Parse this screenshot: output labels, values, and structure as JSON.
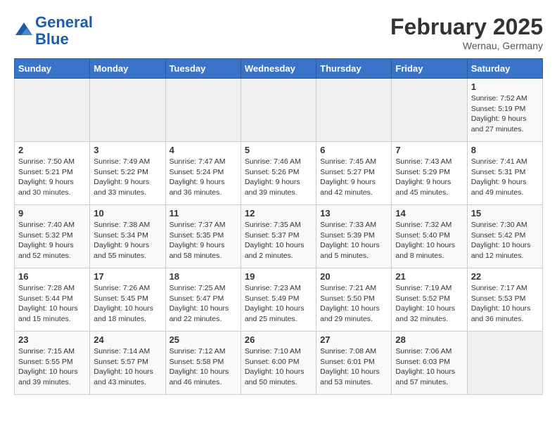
{
  "header": {
    "logo_line1": "General",
    "logo_line2": "Blue",
    "month_year": "February 2025",
    "location": "Wernau, Germany"
  },
  "weekdays": [
    "Sunday",
    "Monday",
    "Tuesday",
    "Wednesday",
    "Thursday",
    "Friday",
    "Saturday"
  ],
  "weeks": [
    [
      {
        "day": "",
        "info": ""
      },
      {
        "day": "",
        "info": ""
      },
      {
        "day": "",
        "info": ""
      },
      {
        "day": "",
        "info": ""
      },
      {
        "day": "",
        "info": ""
      },
      {
        "day": "",
        "info": ""
      },
      {
        "day": "1",
        "info": "Sunrise: 7:52 AM\nSunset: 5:19 PM\nDaylight: 9 hours and 27 minutes."
      }
    ],
    [
      {
        "day": "2",
        "info": "Sunrise: 7:50 AM\nSunset: 5:21 PM\nDaylight: 9 hours and 30 minutes."
      },
      {
        "day": "3",
        "info": "Sunrise: 7:49 AM\nSunset: 5:22 PM\nDaylight: 9 hours and 33 minutes."
      },
      {
        "day": "4",
        "info": "Sunrise: 7:47 AM\nSunset: 5:24 PM\nDaylight: 9 hours and 36 minutes."
      },
      {
        "day": "5",
        "info": "Sunrise: 7:46 AM\nSunset: 5:26 PM\nDaylight: 9 hours and 39 minutes."
      },
      {
        "day": "6",
        "info": "Sunrise: 7:45 AM\nSunset: 5:27 PM\nDaylight: 9 hours and 42 minutes."
      },
      {
        "day": "7",
        "info": "Sunrise: 7:43 AM\nSunset: 5:29 PM\nDaylight: 9 hours and 45 minutes."
      },
      {
        "day": "8",
        "info": "Sunrise: 7:41 AM\nSunset: 5:31 PM\nDaylight: 9 hours and 49 minutes."
      }
    ],
    [
      {
        "day": "9",
        "info": "Sunrise: 7:40 AM\nSunset: 5:32 PM\nDaylight: 9 hours and 52 minutes."
      },
      {
        "day": "10",
        "info": "Sunrise: 7:38 AM\nSunset: 5:34 PM\nDaylight: 9 hours and 55 minutes."
      },
      {
        "day": "11",
        "info": "Sunrise: 7:37 AM\nSunset: 5:35 PM\nDaylight: 9 hours and 58 minutes."
      },
      {
        "day": "12",
        "info": "Sunrise: 7:35 AM\nSunset: 5:37 PM\nDaylight: 10 hours and 2 minutes."
      },
      {
        "day": "13",
        "info": "Sunrise: 7:33 AM\nSunset: 5:39 PM\nDaylight: 10 hours and 5 minutes."
      },
      {
        "day": "14",
        "info": "Sunrise: 7:32 AM\nSunset: 5:40 PM\nDaylight: 10 hours and 8 minutes."
      },
      {
        "day": "15",
        "info": "Sunrise: 7:30 AM\nSunset: 5:42 PM\nDaylight: 10 hours and 12 minutes."
      }
    ],
    [
      {
        "day": "16",
        "info": "Sunrise: 7:28 AM\nSunset: 5:44 PM\nDaylight: 10 hours and 15 minutes."
      },
      {
        "day": "17",
        "info": "Sunrise: 7:26 AM\nSunset: 5:45 PM\nDaylight: 10 hours and 18 minutes."
      },
      {
        "day": "18",
        "info": "Sunrise: 7:25 AM\nSunset: 5:47 PM\nDaylight: 10 hours and 22 minutes."
      },
      {
        "day": "19",
        "info": "Sunrise: 7:23 AM\nSunset: 5:49 PM\nDaylight: 10 hours and 25 minutes."
      },
      {
        "day": "20",
        "info": "Sunrise: 7:21 AM\nSunset: 5:50 PM\nDaylight: 10 hours and 29 minutes."
      },
      {
        "day": "21",
        "info": "Sunrise: 7:19 AM\nSunset: 5:52 PM\nDaylight: 10 hours and 32 minutes."
      },
      {
        "day": "22",
        "info": "Sunrise: 7:17 AM\nSunset: 5:53 PM\nDaylight: 10 hours and 36 minutes."
      }
    ],
    [
      {
        "day": "23",
        "info": "Sunrise: 7:15 AM\nSunset: 5:55 PM\nDaylight: 10 hours and 39 minutes."
      },
      {
        "day": "24",
        "info": "Sunrise: 7:14 AM\nSunset: 5:57 PM\nDaylight: 10 hours and 43 minutes."
      },
      {
        "day": "25",
        "info": "Sunrise: 7:12 AM\nSunset: 5:58 PM\nDaylight: 10 hours and 46 minutes."
      },
      {
        "day": "26",
        "info": "Sunrise: 7:10 AM\nSunset: 6:00 PM\nDaylight: 10 hours and 50 minutes."
      },
      {
        "day": "27",
        "info": "Sunrise: 7:08 AM\nSunset: 6:01 PM\nDaylight: 10 hours and 53 minutes."
      },
      {
        "day": "28",
        "info": "Sunrise: 7:06 AM\nSunset: 6:03 PM\nDaylight: 10 hours and 57 minutes."
      },
      {
        "day": "",
        "info": ""
      }
    ]
  ]
}
